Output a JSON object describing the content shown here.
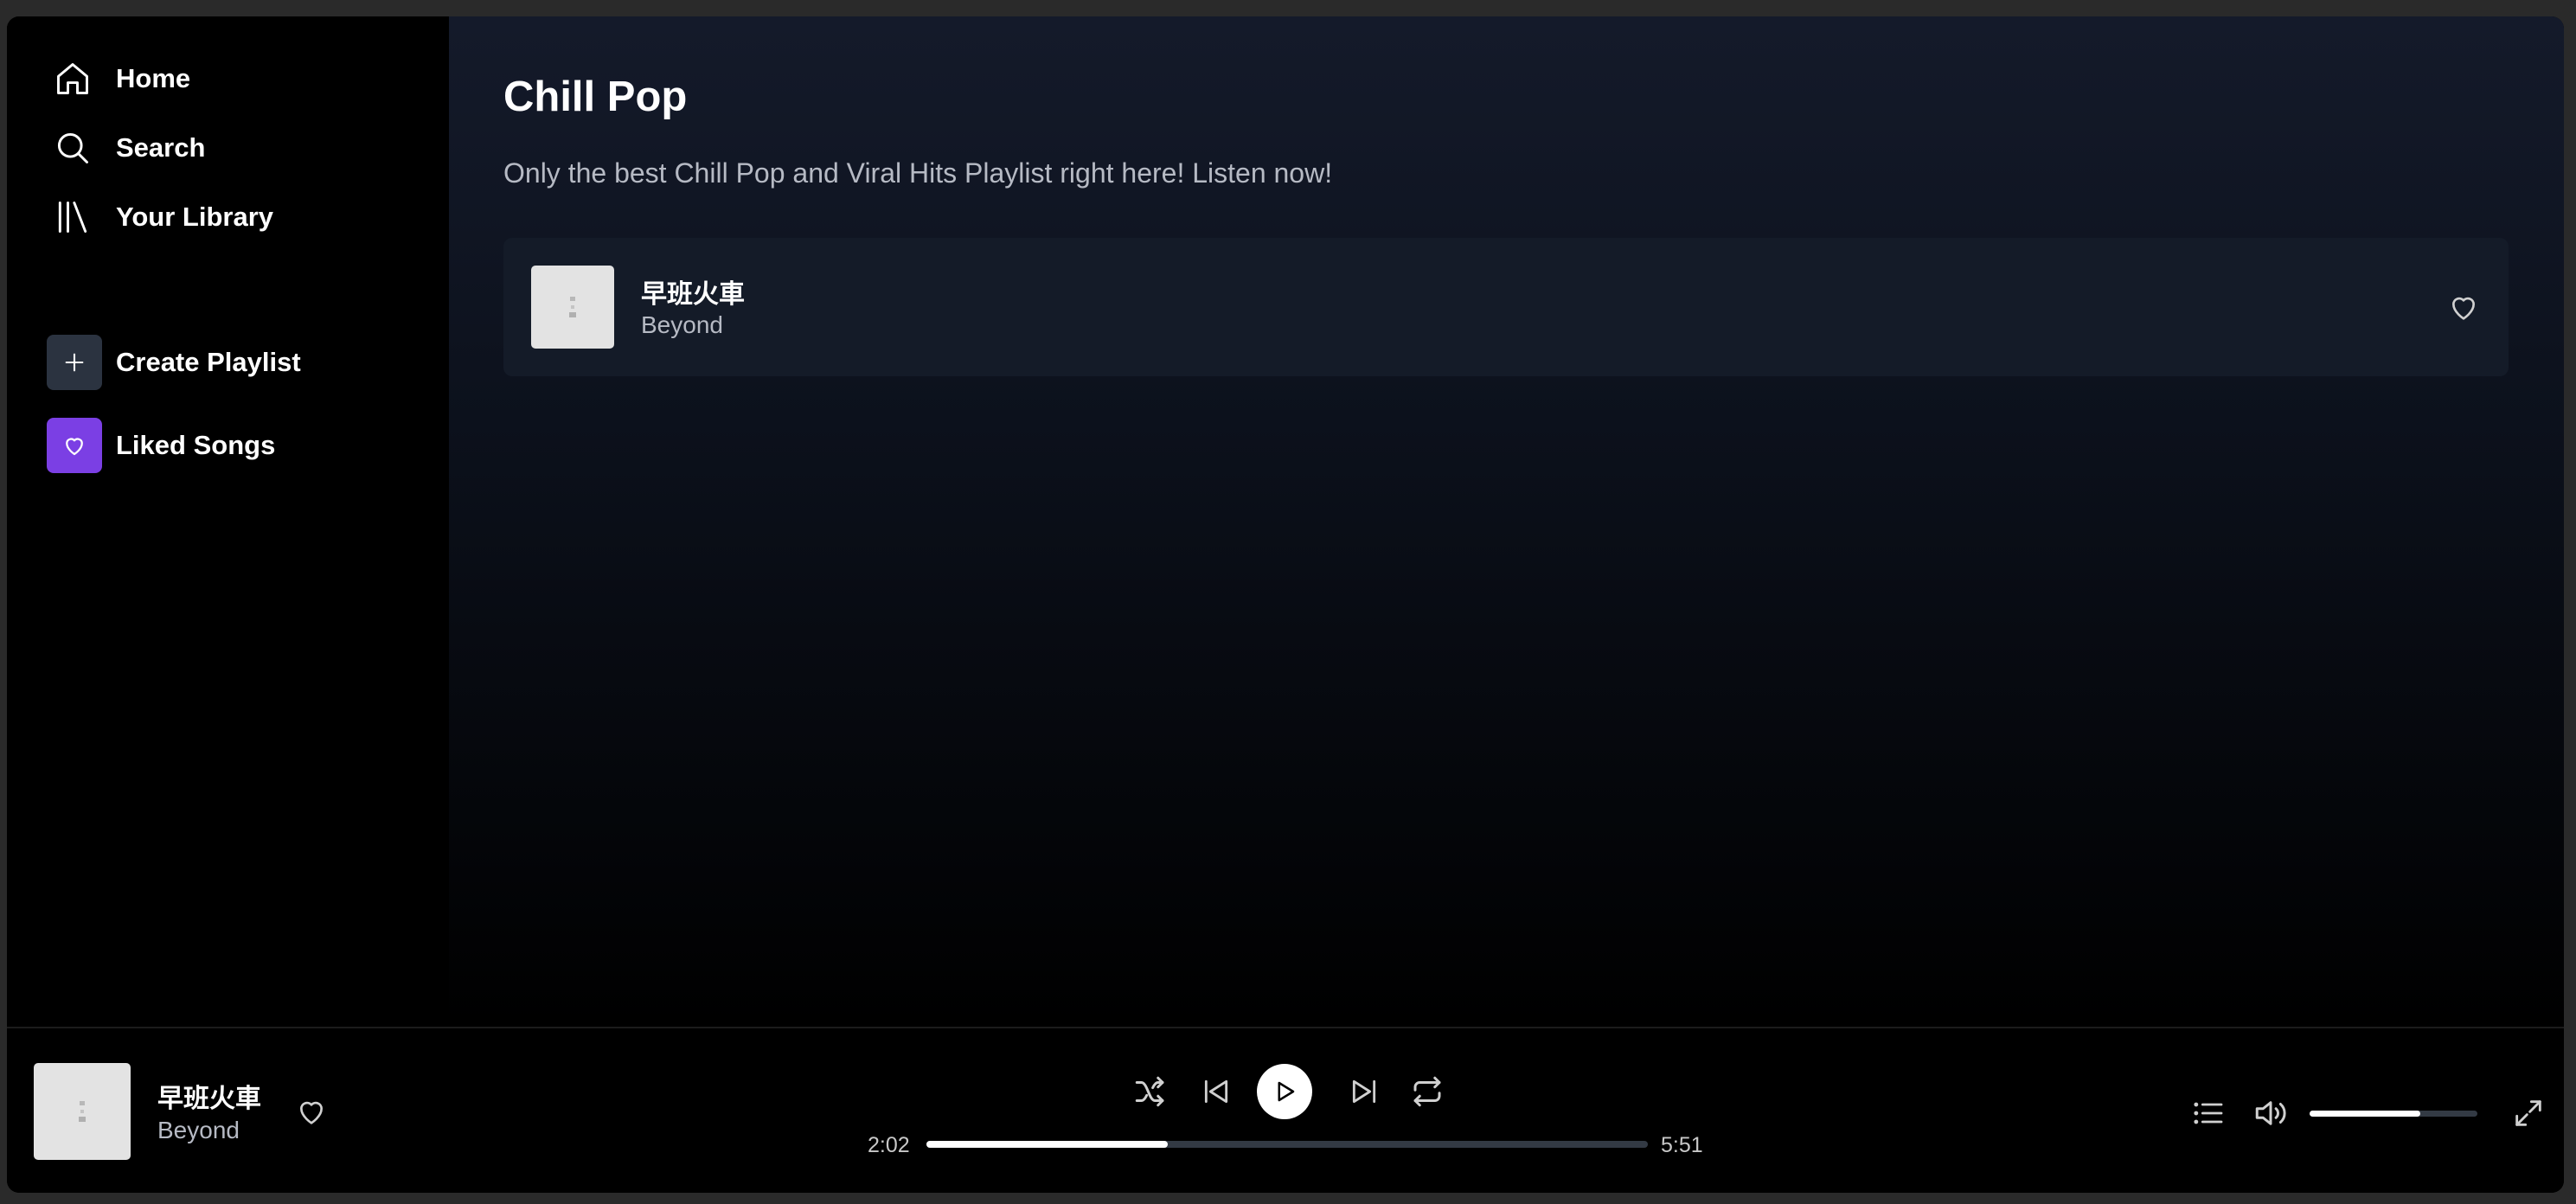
{
  "sidebar": {
    "nav": [
      {
        "label": "Home",
        "icon": "home-icon"
      },
      {
        "label": "Search",
        "icon": "search-icon"
      },
      {
        "label": "Your Library",
        "icon": "library-icon"
      }
    ],
    "actions": [
      {
        "label": "Create Playlist",
        "icon": "plus-icon"
      },
      {
        "label": "Liked Songs",
        "icon": "heart-icon"
      }
    ]
  },
  "playlist": {
    "title": "Chill Pop",
    "description": "Only the best Chill Pop and Viral Hits Playlist right here! Listen now!",
    "tracks": [
      {
        "title": "早班火車",
        "artist": "Beyond"
      }
    ]
  },
  "player": {
    "now_playing": {
      "title": "早班火車",
      "artist": "Beyond"
    },
    "current_time": "2:02",
    "total_time": "5:51",
    "progress_fraction": 0.335,
    "volume_fraction": 0.66
  },
  "colors": {
    "accent_purple": "#7b3fe4",
    "sidebar_bg": "#000000",
    "row_bg": "#141b28",
    "muted_text": "#b6bac4"
  }
}
